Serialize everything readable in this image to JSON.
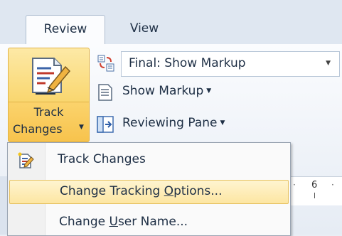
{
  "tabs": [
    {
      "label": "Review",
      "active": true
    },
    {
      "label": "View",
      "active": false
    }
  ],
  "ribbon": {
    "track_changes": {
      "line1": "Track",
      "line2": "Changes"
    },
    "markup_dropdown": {
      "value": "Final: Show Markup"
    },
    "show_markup": {
      "label": "Show Markup"
    },
    "reviewing_pane": {
      "label": "Reviewing Pane"
    }
  },
  "ruler": {
    "number": "6"
  },
  "menu": {
    "items": [
      {
        "pre": "Track Chan",
        "key": "g",
        "post": "es",
        "highlighted": false
      },
      {
        "pre": "Change Tracking ",
        "key": "O",
        "post": "ptions...",
        "highlighted": true
      },
      {
        "pre": "Change ",
        "key": "U",
        "post": "ser Name...",
        "highlighted": false
      }
    ]
  },
  "colors": {
    "highlight": "#fde6a2",
    "accent": "#f9d66e",
    "ribbon_text": "#1e2f45"
  }
}
